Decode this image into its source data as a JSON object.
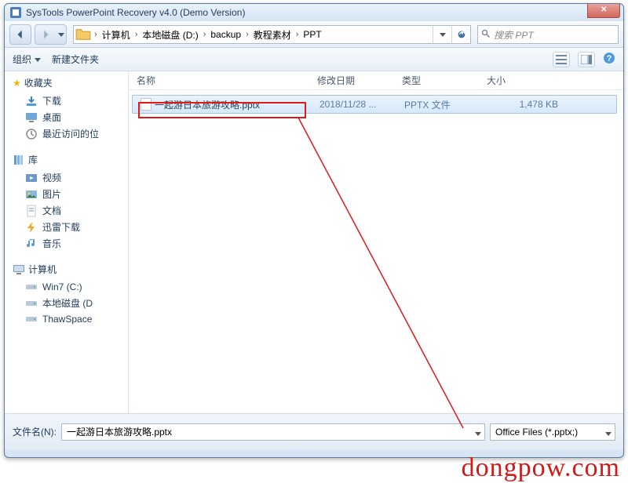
{
  "window_title": "SysTools PowerPoint Recovery v4.0 (Demo Version)",
  "breadcrumb": [
    "计算机",
    "本地磁盘 (D:)",
    "backup",
    "教程素材",
    "PPT"
  ],
  "search_placeholder": "搜索 PPT",
  "toolbar": {
    "organize": "组织",
    "new_folder": "新建文件夹"
  },
  "sidebar": {
    "favorites": {
      "label": "收藏夹",
      "items": [
        "下载",
        "桌面",
        "最近访问的位"
      ]
    },
    "libraries": {
      "label": "库",
      "items": [
        "视频",
        "图片",
        "文档",
        "迅雷下载",
        "音乐"
      ]
    },
    "computer": {
      "label": "计算机",
      "items": [
        "Win7 (C:)",
        "本地磁盘 (D",
        "ThawSpace"
      ]
    }
  },
  "columns": {
    "name": "名称",
    "date": "修改日期",
    "type": "类型",
    "size": "大小"
  },
  "files": [
    {
      "name": "一起游日本旅游攻略.pptx",
      "date": "2018/11/28 ...",
      "type": "PPTX 文件",
      "size": "1,478 KB"
    }
  ],
  "footer": {
    "filename_label": "文件名(N):",
    "filename_value": "一起游日本旅游攻略.pptx",
    "filetype": "Office Files (*.pptx;)"
  },
  "watermark": "dongpow.com"
}
